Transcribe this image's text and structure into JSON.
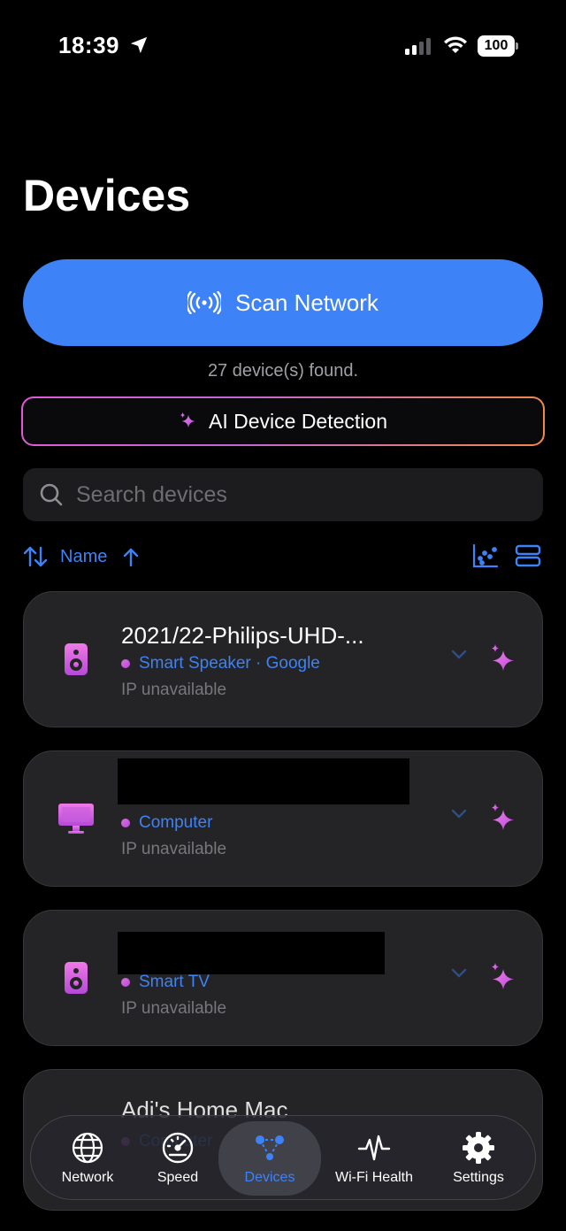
{
  "status": {
    "time": "18:39",
    "battery": "100"
  },
  "page": {
    "title": "Devices"
  },
  "scan": {
    "label": "Scan Network",
    "found": "27 device(s) found."
  },
  "ai": {
    "label": "AI Device Detection"
  },
  "search": {
    "placeholder": "Search devices"
  },
  "sort": {
    "label": "Name"
  },
  "devices": [
    {
      "name": "2021/22-Philips-UHD-...",
      "type": "Smart Speaker · Google",
      "ip": "IP unavailable",
      "icon": "speaker-icon"
    },
    {
      "name": "",
      "type": "Computer",
      "ip": "IP unavailable",
      "icon": "monitor-icon"
    },
    {
      "name": "",
      "type": "Smart TV",
      "ip": "IP unavailable",
      "icon": "speaker-icon"
    },
    {
      "name": "Adi's Home Mac",
      "type": "Computer",
      "ip": "",
      "icon": "monitor-icon"
    }
  ],
  "tabs": [
    {
      "label": "Network",
      "icon": "globe-icon"
    },
    {
      "label": "Speed",
      "icon": "speedometer-icon"
    },
    {
      "label": "Devices",
      "icon": "devices-icon",
      "active": true
    },
    {
      "label": "Wi-Fi Health",
      "icon": "waveform-icon"
    },
    {
      "label": "Settings",
      "icon": "gear-icon"
    }
  ],
  "colors": {
    "accent": "#3d82f6",
    "magenta": "#d95fdc",
    "card": "#242426"
  }
}
